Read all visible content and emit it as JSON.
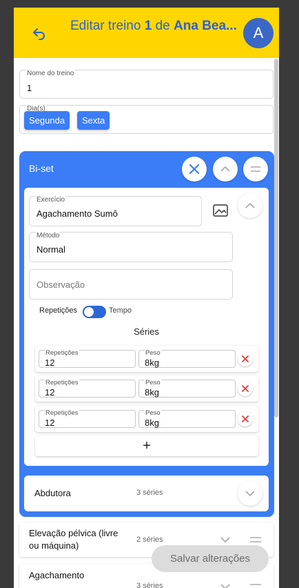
{
  "header": {
    "title_prefix": "Editar treino ",
    "workout_number": "1",
    "title_middle": " de ",
    "student_name": "Ana Bea...",
    "avatar_letter": "A"
  },
  "form": {
    "name_label": "Nome do treino",
    "name_value": "1",
    "days_label": "Dia(s)",
    "days": [
      "Segunda",
      "Sexta"
    ]
  },
  "biset": {
    "title": "Bi-set",
    "exercise_label": "Exercício",
    "exercise_value": "Agachamento Sumô",
    "method_label": "Método",
    "method_value": "Normal",
    "observation_placeholder": "Observação",
    "toggle_left": "Repetições",
    "toggle_right": "Tempo",
    "series_title": "Séries",
    "series": [
      {
        "reps_label": "Repetições",
        "reps": "12",
        "weight_label": "Peso",
        "weight": "8kg"
      },
      {
        "reps_label": "Repetições",
        "reps": "12",
        "weight_label": "Peso",
        "weight": "8kg"
      },
      {
        "reps_label": "Repetições",
        "reps": "12",
        "weight_label": "Peso",
        "weight": "8kg"
      }
    ],
    "add_symbol": "+",
    "second_exercise": {
      "name": "Abdutora",
      "count": "3 séries"
    }
  },
  "exercises": [
    {
      "name": "Elevação pélvica (livre ou máquina)",
      "count": "2 séries"
    },
    {
      "name": "Agachamento",
      "count": "3 séries"
    }
  ],
  "save_label": "Salvar alterações",
  "colors": {
    "header": "#ffd600",
    "primary": "#3b7df6",
    "title": "#2b61d1",
    "delete": "#e53935"
  }
}
